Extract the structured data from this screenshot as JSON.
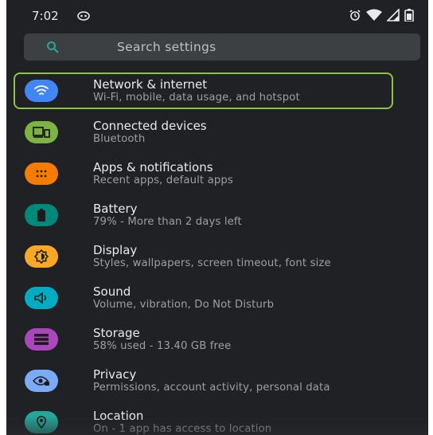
{
  "status_bar": {
    "time": "7:02",
    "left_icon": "notification-icon",
    "right_icons": [
      "alarm-icon",
      "wifi-icon",
      "signal-icon",
      "battery-icon"
    ]
  },
  "search": {
    "placeholder": "Search settings",
    "icon": "search-icon"
  },
  "settings": [
    {
      "id": "network",
      "title": "Network & internet",
      "subtitle": "Wi-Fi, mobile, data usage, and hotspot",
      "icon": "wifi-icon",
      "color": "#4285f4"
    },
    {
      "id": "connected",
      "title": "Connected devices",
      "subtitle": "Bluetooth",
      "icon": "devices-icon",
      "color": "#7cb342"
    },
    {
      "id": "apps",
      "title": "Apps & notifications",
      "subtitle": "Recent apps, default apps",
      "icon": "apps-grid-icon",
      "color": "#f57c00"
    },
    {
      "id": "battery",
      "title": "Battery",
      "subtitle": "79% - More than 2 days left",
      "icon": "battery-icon",
      "color": "#00897b"
    },
    {
      "id": "display",
      "title": "Display",
      "subtitle": "Styles, wallpapers, screen timeout, font size",
      "icon": "brightness-icon",
      "color": "#f9a825"
    },
    {
      "id": "sound",
      "title": "Sound",
      "subtitle": "Volume, vibration, Do Not Disturb",
      "icon": "volume-icon",
      "color": "#00acc1"
    },
    {
      "id": "storage",
      "title": "Storage",
      "subtitle": "58% used - 13.40 GB free",
      "icon": "storage-icon",
      "color": "#ab47bc"
    },
    {
      "id": "privacy",
      "title": "Privacy",
      "subtitle": "Permissions, account activity, personal data",
      "icon": "privacy-eye-icon",
      "color": "#7baaf7"
    },
    {
      "id": "location",
      "title": "Location",
      "subtitle": "On - 1 app has access to location",
      "icon": "location-pin-icon",
      "color": "#26a69a"
    }
  ],
  "highlighted_item": "network",
  "colors": {
    "background": "#202124",
    "search_bar": "#3c4043",
    "title_text": "#e8eaed",
    "subtitle_text": "#9aa0a6",
    "highlight_border": "#8bc34a"
  }
}
